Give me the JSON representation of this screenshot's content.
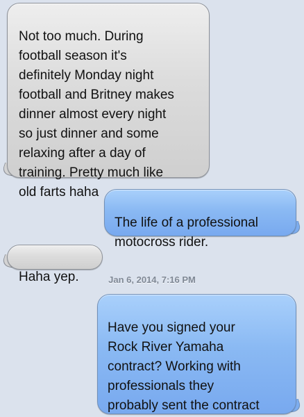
{
  "conversation": {
    "messages": [
      {
        "direction": "incoming",
        "text": "Not too much. During\nfootball season it's\ndefinitely Monday night\nfootball and Britney makes\ndinner almost every night\nso just dinner and some\nrelaxing after a day of\ntraining. Pretty much like\nold farts haha"
      },
      {
        "direction": "outgoing",
        "text": "The life of a professional\nmotocross rider."
      },
      {
        "direction": "incoming",
        "text": "Haha yep."
      },
      {
        "direction": "outgoing",
        "text": "Have you signed your\nRock River Yamaha\ncontract?  Working with\nprofessionals they\nprobably sent the contract\nright over."
      }
    ],
    "timestamp": "Jan 6, 2014, 7:16 PM"
  },
  "colors": {
    "background": "#dbe2ed",
    "incoming_bubble": "#dcdcdc",
    "outgoing_bubble": "#8ab9f3",
    "timestamp_text": "#7f8895"
  }
}
